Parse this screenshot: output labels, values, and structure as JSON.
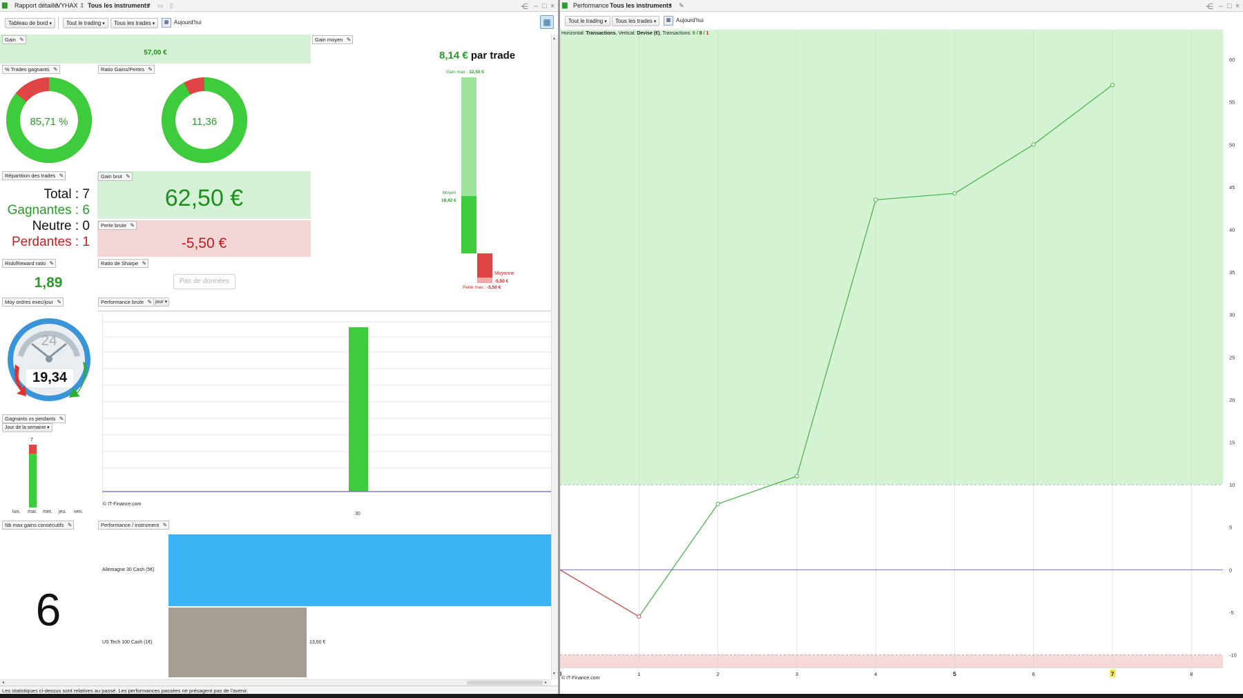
{
  "left_window": {
    "tab_title": "Rapport détaillé",
    "account": "VYHAX",
    "instruments": "Tous les instruments",
    "toolbar": {
      "dashboard": "Tableau de bord",
      "trading": "Tout le trading",
      "trades": "Tous les trades",
      "today": "Aujourd'hui"
    },
    "gain": {
      "label": "Gain",
      "value": "57,00 €"
    },
    "gain_moyen": {
      "label": "Gain moyen",
      "value": "8,14 €",
      "suffix": "par trade",
      "max_gain_label": "Gain max :",
      "max_gain_value": "32,50 €",
      "moyen_label": "Moyen",
      "moyen_value": "18,42 €",
      "moyenne_label": "Moyenne",
      "moyenne_value": "-5,50 €",
      "max_loss_label": "Perte max :",
      "max_loss_value": "-5,50 €"
    },
    "pct_winning": {
      "label": "% Trades gagnants",
      "value": "85,71 %",
      "fraction": 0.8571
    },
    "ratio_gains": {
      "label": "Ratio Gains/Pertes",
      "value": "11,36",
      "fraction": 0.919
    },
    "repartition": {
      "label": "Répartition des trades",
      "total": "Total : 7",
      "gagnantes": "Gagnantes : 6",
      "neutre": "Neutre : 0",
      "perdantes": "Perdantes : 1"
    },
    "gain_brut": {
      "label": "Gain brut",
      "value": "62,50 €"
    },
    "perte_brute": {
      "label": "Perte brute",
      "value": "-5,50 €"
    },
    "risk_reward": {
      "label": "Risk/Reward ratio",
      "value": "1,89"
    },
    "sharpe": {
      "label": "Ratio de Sharpe",
      "value": "Pas de données"
    },
    "moy_ordres": {
      "label": "Moy ordres exec/jour",
      "gauge_top": "24",
      "value": "19,34"
    },
    "perf_brute": {
      "label": "Performance brute",
      "period": "jour",
      "copyright": "© IT-Finance.com",
      "x_label": "30"
    },
    "gagnants_vs_perdants": {
      "label": "Gagnants vs perdants",
      "group": "Jour de la semaine",
      "top_value": "7",
      "days": [
        "lun.",
        "mar.",
        "mer.",
        "jeu.",
        "ven."
      ]
    },
    "nb_max_gains": {
      "label": "Nb max gains consécutifs",
      "value": "6"
    },
    "perf_instrument": {
      "label": "Performance / instrument",
      "rows": [
        {
          "name": "Allemagne 30 Cash (5€)",
          "value": "",
          "color": "#39b4f5"
        },
        {
          "name": "US Tech 100 Cash (1€)",
          "value": "13,50 €",
          "color": "#a69e93"
        }
      ]
    },
    "disclaimer": "Les statistiques ci-dessus sont relatives au passé. Les performances passées ne présagent pas de l'avenir."
  },
  "right_window": {
    "tab_title": "Performance",
    "instruments": "Tous les instruments",
    "toolbar": {
      "trading": "Tout le trading",
      "trades": "Tous les trades",
      "today": "Aujourd'hui"
    },
    "info": {
      "horizontal_label": "Horizontal:",
      "horizontal_value": "Transactions",
      "vertical_label": "Vertical:",
      "vertical_value": "Devise (€)",
      "tx_label": "Transactions:",
      "tx_win": "6",
      "tx_neutral": "0",
      "tx_loss": "1"
    },
    "copyright": "© IT-Finance.com"
  },
  "chart_data": {
    "type": "line",
    "title": "",
    "xlabel": "Transactions",
    "ylabel": "Devise (€)",
    "x": [
      0,
      1,
      2,
      3,
      4,
      5,
      6,
      7
    ],
    "y": [
      0,
      -5.5,
      7.75,
      11,
      43.5,
      44.25,
      50,
      57
    ],
    "x_ticks": [
      "0",
      "1",
      "2",
      "3",
      "4",
      "5",
      "6",
      "7",
      "8"
    ],
    "y_ticks": [
      60,
      55,
      50,
      45,
      40,
      35,
      30,
      25,
      20,
      15,
      10,
      5,
      0,
      -5,
      -10
    ],
    "xlim": [
      0,
      8.4
    ],
    "ylim": [
      -11.5,
      63.5
    ],
    "highlight_x": "7",
    "green_zone_from": 10,
    "red_zone_below": -10,
    "colors": {
      "up": "#4fb34f",
      "down": "#c0504d",
      "zero_line": "#7b7bd6",
      "zone_green": "#d3f3d3",
      "zone_red": "#f7d9d9"
    }
  }
}
